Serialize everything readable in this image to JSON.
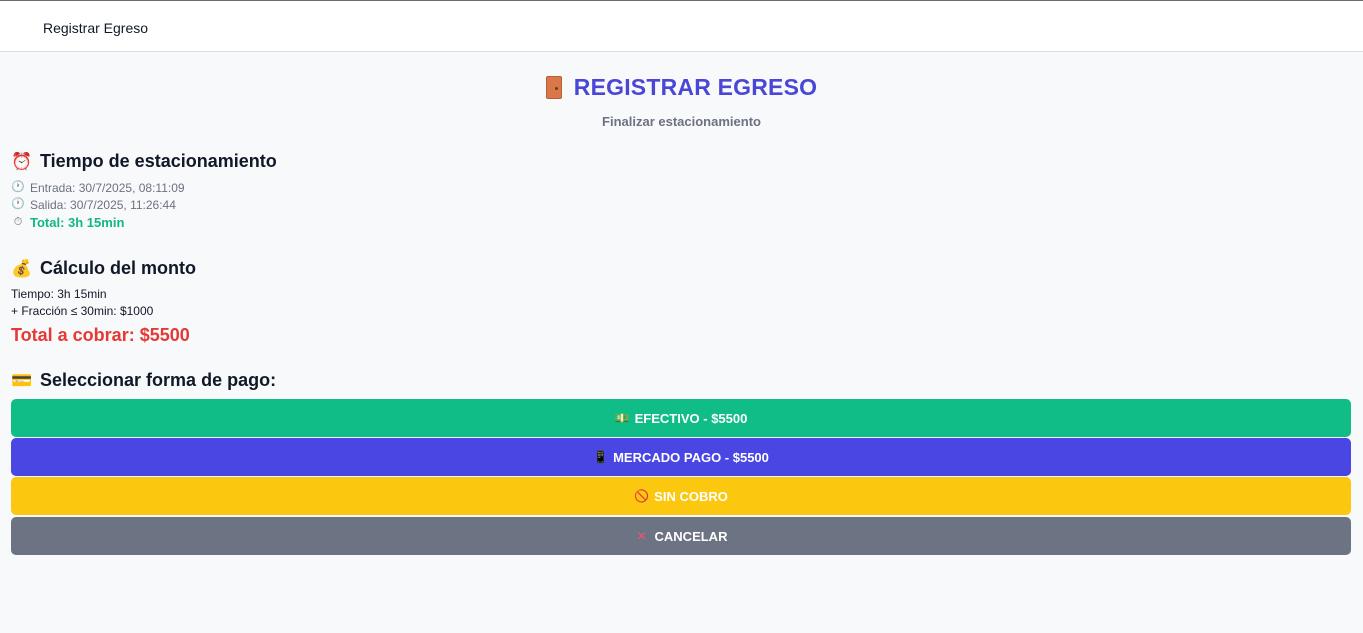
{
  "topbar": {
    "title": "Registrar Egreso"
  },
  "header": {
    "title": "REGISTRAR EGRESO",
    "icon": "door-icon",
    "subtitle": "Finalizar estacionamiento"
  },
  "time_section": {
    "icon": "alarm-clock-icon",
    "heading": "Tiempo de estacionamiento",
    "entry": "Entrada: 30/7/2025, 08:11:09",
    "exit": "Salida: 30/7/2025, 11:26:44",
    "total": "Total: 3h 15min"
  },
  "amount_section": {
    "icon": "money-bag-icon",
    "heading": "Cálculo del monto",
    "time_line": "Tiempo: 3h 15min",
    "fraction_line": "+ Fracción ≤ 30min: $1000",
    "total_line": "Total a cobrar: $5500"
  },
  "payment_section": {
    "icon": "credit-card-icon",
    "heading": "Seleccionar forma de pago:",
    "buttons": [
      {
        "label": "EFECTIVO - $5500",
        "icon": "dollar-bill-icon",
        "color": "#10bd87"
      },
      {
        "label": "MERCADO PAGO - $5500",
        "icon": "phone-icon",
        "color": "#4a46e3"
      },
      {
        "label": "SIN COBRO",
        "icon": "prohibited-icon",
        "color": "#fcc80f"
      },
      {
        "label": "CANCELAR",
        "icon": "cross-icon",
        "color": "#6c7483"
      }
    ]
  },
  "colors": {
    "title": "#4a47d6",
    "total_time": "#10b981",
    "total_charge": "#e53935"
  }
}
